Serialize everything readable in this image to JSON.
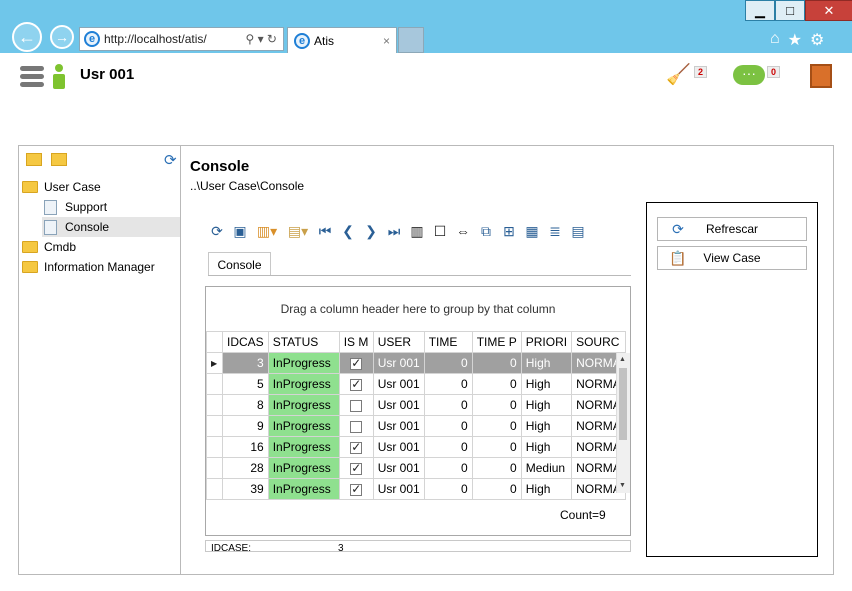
{
  "browser": {
    "address": "http://localhost/atis/",
    "tab_title": "Atis",
    "tab_close": "×",
    "minimize": "▁",
    "maximize": "□",
    "close": "✕"
  },
  "header": {
    "user": "Usr 001",
    "notifications_count": "2",
    "messages_count": "0"
  },
  "tree": {
    "items": [
      {
        "label": "User Case",
        "type": "folder"
      },
      {
        "label": "Support",
        "type": "doc"
      },
      {
        "label": "Console",
        "type": "doc"
      },
      {
        "label": "Cmdb",
        "type": "folder"
      },
      {
        "label": "Information Manager",
        "type": "folder"
      }
    ]
  },
  "main": {
    "title": "Console",
    "breadcrumb": "..\\User Case\\Console",
    "tab": "Console",
    "group_hint": "Drag a column header here to group by that column",
    "count": "Count=9",
    "footer_label": "IDCASE:",
    "footer_value": "3"
  },
  "grid": {
    "columns": [
      "IDCAS",
      "STATUS",
      "IS M",
      "USER",
      "TIME",
      "TIME P",
      "PRIORI",
      "SOURC"
    ],
    "rows": [
      {
        "id": "3",
        "status": "InProgress",
        "ism": true,
        "user": "Usr 001",
        "time": "0",
        "timep": "0",
        "priority": "High",
        "source": "NORMA"
      },
      {
        "id": "5",
        "status": "InProgress",
        "ism": true,
        "user": "Usr 001",
        "time": "0",
        "timep": "0",
        "priority": "High",
        "source": "NORMA"
      },
      {
        "id": "8",
        "status": "InProgress",
        "ism": false,
        "user": "Usr 001",
        "time": "0",
        "timep": "0",
        "priority": "High",
        "source": "NORMA"
      },
      {
        "id": "9",
        "status": "InProgress",
        "ism": false,
        "user": "Usr 001",
        "time": "0",
        "timep": "0",
        "priority": "High",
        "source": "NORMA"
      },
      {
        "id": "16",
        "status": "InProgress",
        "ism": true,
        "user": "Usr 001",
        "time": "0",
        "timep": "0",
        "priority": "High",
        "source": "NORMA"
      },
      {
        "id": "28",
        "status": "InProgress",
        "ism": true,
        "user": "Usr 001",
        "time": "0",
        "timep": "0",
        "priority": "Mediun",
        "source": "NORMA"
      },
      {
        "id": "39",
        "status": "InProgress",
        "ism": true,
        "user": "Usr 001",
        "time": "0",
        "timep": "0",
        "priority": "High",
        "source": "NORMA"
      }
    ]
  },
  "actions": {
    "refresh": "Refrescar",
    "view_case": "View Case"
  }
}
